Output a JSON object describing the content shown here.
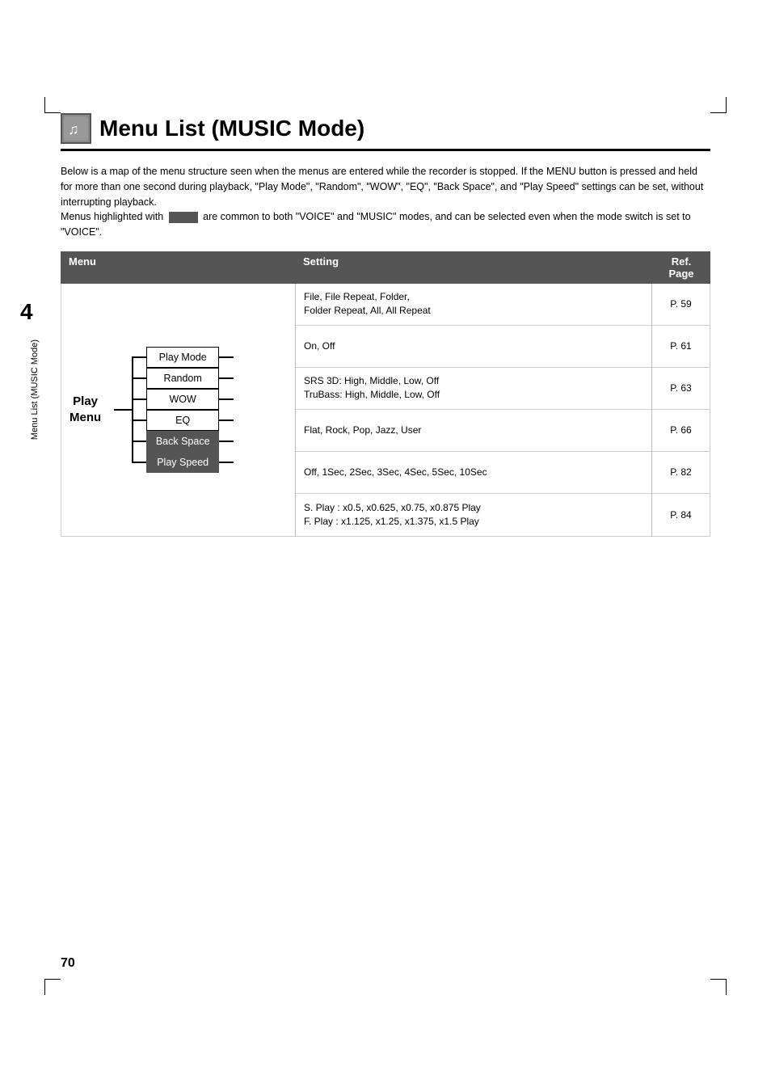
{
  "page": {
    "number": "70",
    "chapter": "4"
  },
  "title": {
    "text": "Menu List (MUSIC Mode)",
    "icon": "🎵"
  },
  "sidebar_label": "Menu List (MUSIC Mode)",
  "description": {
    "line1": "Below is a map of the menu structure seen when the menus are entered while the recorder is",
    "line2": "stopped.  If the MENU button is pressed and held for more than one second during playback,",
    "line3": "\"Play Mode\", \"Random\", \"WOW\", \"EQ\", \"Back Space\", and \"Play Speed\" settings can be set,",
    "line4": "without interrupting playback.",
    "line5": "Menus highlighted with",
    "line6": "are common to both \"VOICE\" and \"MUSIC\" modes, and can",
    "line7": "be selected even when the mode switch is set to \"VOICE\"."
  },
  "table": {
    "headers": {
      "menu": "Menu",
      "setting": "Setting",
      "ref_page": "Ref. Page"
    },
    "root_label": "Play\nMenu",
    "menu_items": [
      {
        "label": "Play Mode",
        "highlighted": false
      },
      {
        "label": "Random",
        "highlighted": false
      },
      {
        "label": "WOW",
        "highlighted": false
      },
      {
        "label": "EQ",
        "highlighted": false
      },
      {
        "label": "Back Space",
        "highlighted": true
      },
      {
        "label": "Play Speed",
        "highlighted": true
      }
    ],
    "settings": [
      {
        "text": "File, File Repeat, Folder,\nFolder Repeat, All, All Repeat",
        "page": "P. 59"
      },
      {
        "text": "On, Off",
        "page": "P. 61"
      },
      {
        "text": "SRS 3D: High, Middle, Low, Off\nTruBass: High, Middle, Low, Off",
        "page": "P. 63"
      },
      {
        "text": "Flat, Rock, Pop, Jazz, User",
        "page": "P. 66"
      },
      {
        "text": "Off, 1Sec, 2Sec, 3Sec, 4Sec, 5Sec, 10Sec",
        "page": "P. 82"
      },
      {
        "text": "S. Play : x0.5, x0.625, x0.75, x0.875 Play\nF. Play : x1.125, x1.25, x1.375, x1.5 Play",
        "page": "P. 84"
      }
    ]
  }
}
